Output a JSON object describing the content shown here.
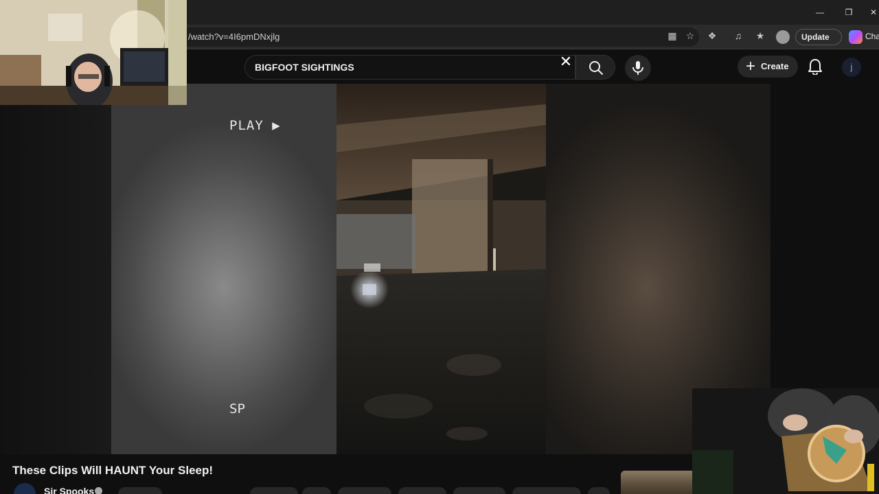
{
  "browser": {
    "url": "/watch?v=4I6pmDNxjlg",
    "update_label": "Update",
    "update_more": "···",
    "copilot_label": "Cha",
    "window_controls": [
      "minimize-icon",
      "restore-icon",
      "close-icon"
    ]
  },
  "masthead": {
    "search_query": "BIGFOOT SIGHTINGS",
    "create_label": "Create",
    "avatar_initial": "j"
  },
  "player": {
    "overlay_play": "PLAY ▶",
    "overlay_sp": "SP"
  },
  "video": {
    "title": "These Clips Will HAUNT Your Sleep!",
    "channel": "Sir Spooks"
  },
  "colors": {
    "background": "#0f0f0f",
    "chrome": "#1f1f1f",
    "accent": "#3ea6ff"
  }
}
